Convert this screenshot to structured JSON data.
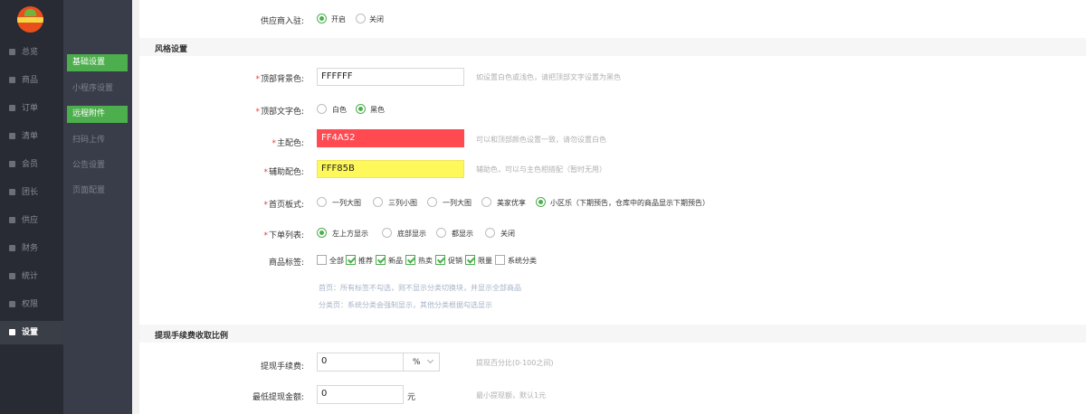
{
  "sidebar": {
    "items": [
      {
        "label": "总览",
        "active": false
      },
      {
        "label": "商品",
        "active": false
      },
      {
        "label": "订单",
        "active": false
      },
      {
        "label": "清单",
        "active": false
      },
      {
        "label": "会员",
        "active": false
      },
      {
        "label": "团长",
        "active": false
      },
      {
        "label": "供应",
        "active": false
      },
      {
        "label": "财务",
        "active": false
      },
      {
        "label": "统计",
        "active": false
      },
      {
        "label": "权限",
        "active": false
      },
      {
        "label": "设置",
        "active": true
      }
    ]
  },
  "subnav": {
    "items": [
      {
        "label": "基础设置",
        "highlighted": true
      },
      {
        "label": "小程序设置",
        "highlighted": false
      },
      {
        "label": "远程附件",
        "highlighted": true
      },
      {
        "label": "扫码上传",
        "highlighted": false
      },
      {
        "label": "公告设置",
        "highlighted": false
      },
      {
        "label": "页面配置",
        "highlighted": false
      }
    ]
  },
  "supplier": {
    "label": "供应商入驻:",
    "options": [
      "开启",
      "关闭"
    ],
    "selected": "开启"
  },
  "style_section": {
    "title": "风格设置",
    "top_bg": {
      "label": "顶部背景色:",
      "value": "FFFFFF",
      "hint": "如设置白色或浅色，请把顶部文字设置为黑色"
    },
    "top_text": {
      "label": "顶部文字色:",
      "options": [
        "白色",
        "黑色"
      ],
      "selected": "黑色"
    },
    "main_color": {
      "label": "主配色:",
      "value": "FF4A52",
      "hint": "可以和顶部颜色设置一致，请勿设置白色",
      "color": "#FF4A52"
    },
    "aux_color": {
      "label": "辅助配色:",
      "value": "FFF85B",
      "hint": "辅助色，可以与主色相搭配（暂时无用）",
      "color": "#FFF85B"
    },
    "home_layout": {
      "label": "首页板式:",
      "options": [
        "一列大图",
        "三列小图",
        "一列大图",
        "美家优享",
        "小区乐（下期预告，仓库中的商品显示下期预告）"
      ],
      "selected": 4
    },
    "order_list": {
      "label": "下单列表:",
      "options": [
        "左上方显示",
        "底部显示",
        "都显示",
        "关闭"
      ],
      "selected": 0
    },
    "tags": {
      "label": "商品标签:",
      "items": [
        {
          "label": "全部",
          "checked": false
        },
        {
          "label": "推荐",
          "checked": true
        },
        {
          "label": "新品",
          "checked": true
        },
        {
          "label": "热卖",
          "checked": true
        },
        {
          "label": "促销",
          "checked": true
        },
        {
          "label": "限量",
          "checked": true
        },
        {
          "label": "系统分类",
          "checked": false
        }
      ],
      "note1": "首页：所有标签不勾选，则不显示分类切换块，并显示全部商品",
      "note2": "分类页：系统分类会强制显示，其他分类根据勾选显示"
    }
  },
  "withdraw_section": {
    "title": "提现手续费收取比例",
    "fee": {
      "label": "提现手续费:",
      "value": "0",
      "unit": "%",
      "hint": "提现百分比(0-100之间)"
    },
    "min": {
      "label": "最低提现金额:",
      "value": "0",
      "unit": "元",
      "hint": "最小提现额，默认1元"
    }
  },
  "colors": {
    "accent": "#4CAE4C",
    "sidebar": "#282B33",
    "subnav": "#393D49"
  }
}
